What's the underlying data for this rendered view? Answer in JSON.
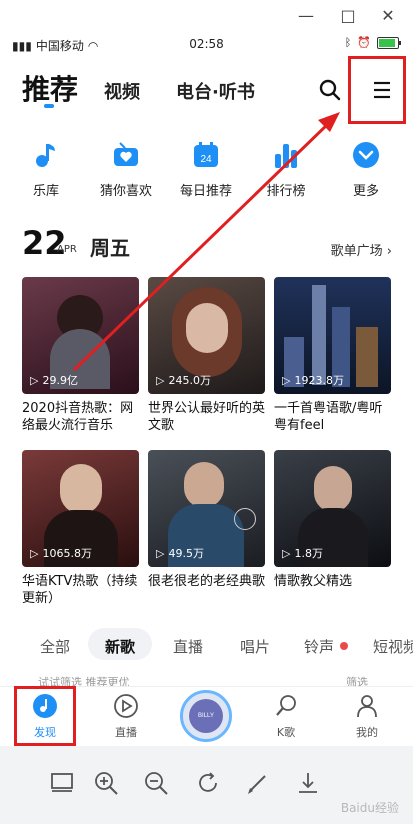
{
  "window": {
    "minimize": "—",
    "maximize": "□",
    "close": "✕"
  },
  "status_bar": {
    "carrier": "中国移动",
    "time": "02:58"
  },
  "top_tabs": {
    "main": "推荐",
    "video": "视频",
    "radio": "电台·听书"
  },
  "quick_entries": [
    {
      "label": "乐库",
      "icon": "music-note-icon"
    },
    {
      "label": "猜你喜欢",
      "icon": "radio-heart-icon"
    },
    {
      "label": "每日推荐",
      "icon": "calendar-icon",
      "badge": "24"
    },
    {
      "label": "排行榜",
      "icon": "ranking-bars-icon"
    },
    {
      "label": "更多",
      "icon": "chevron-down-icon"
    }
  ],
  "date_header": {
    "day": "22",
    "month": "APR",
    "weekday": "周五",
    "playlist_link": "歌单广场"
  },
  "cards": [
    {
      "plays": "29.9亿",
      "title": "2020抖音热歌：网络最火流行音乐",
      "color": "#3a1a2a"
    },
    {
      "plays": "245.0万",
      "title": "世界公认最好听的英文歌",
      "color": "#4a3a3a"
    },
    {
      "plays": "1923.8万",
      "title": "一千首粤语歌/粤听粤有feel",
      "color": "#1e2a4a"
    },
    {
      "plays": "1065.8万",
      "title": "华语KTV热歌（持续更新）",
      "color": "#5a2a2a"
    },
    {
      "plays": "49.5万",
      "title": "很老很老的老经典歌",
      "color": "#2a2f36"
    },
    {
      "plays": "1.8万",
      "title": "情歌教父精选",
      "color": "#1a1d22"
    }
  ],
  "category_tabs": [
    "全部",
    "新歌",
    "直播",
    "唱片",
    "铃声",
    "短视频"
  ],
  "filter_row": {
    "left": "试试筛选   推荐更优",
    "right": "筛选"
  },
  "bottom_nav": {
    "discover": "发现",
    "live": "直播",
    "ksong": "K歌",
    "mine": "我的"
  },
  "center_disc_text": "BILLY MUMS",
  "watermark": "Baidu经验",
  "colors": {
    "accent": "#1e8ff5",
    "highlight_box": "#e02020",
    "arrow": "#e02020"
  }
}
